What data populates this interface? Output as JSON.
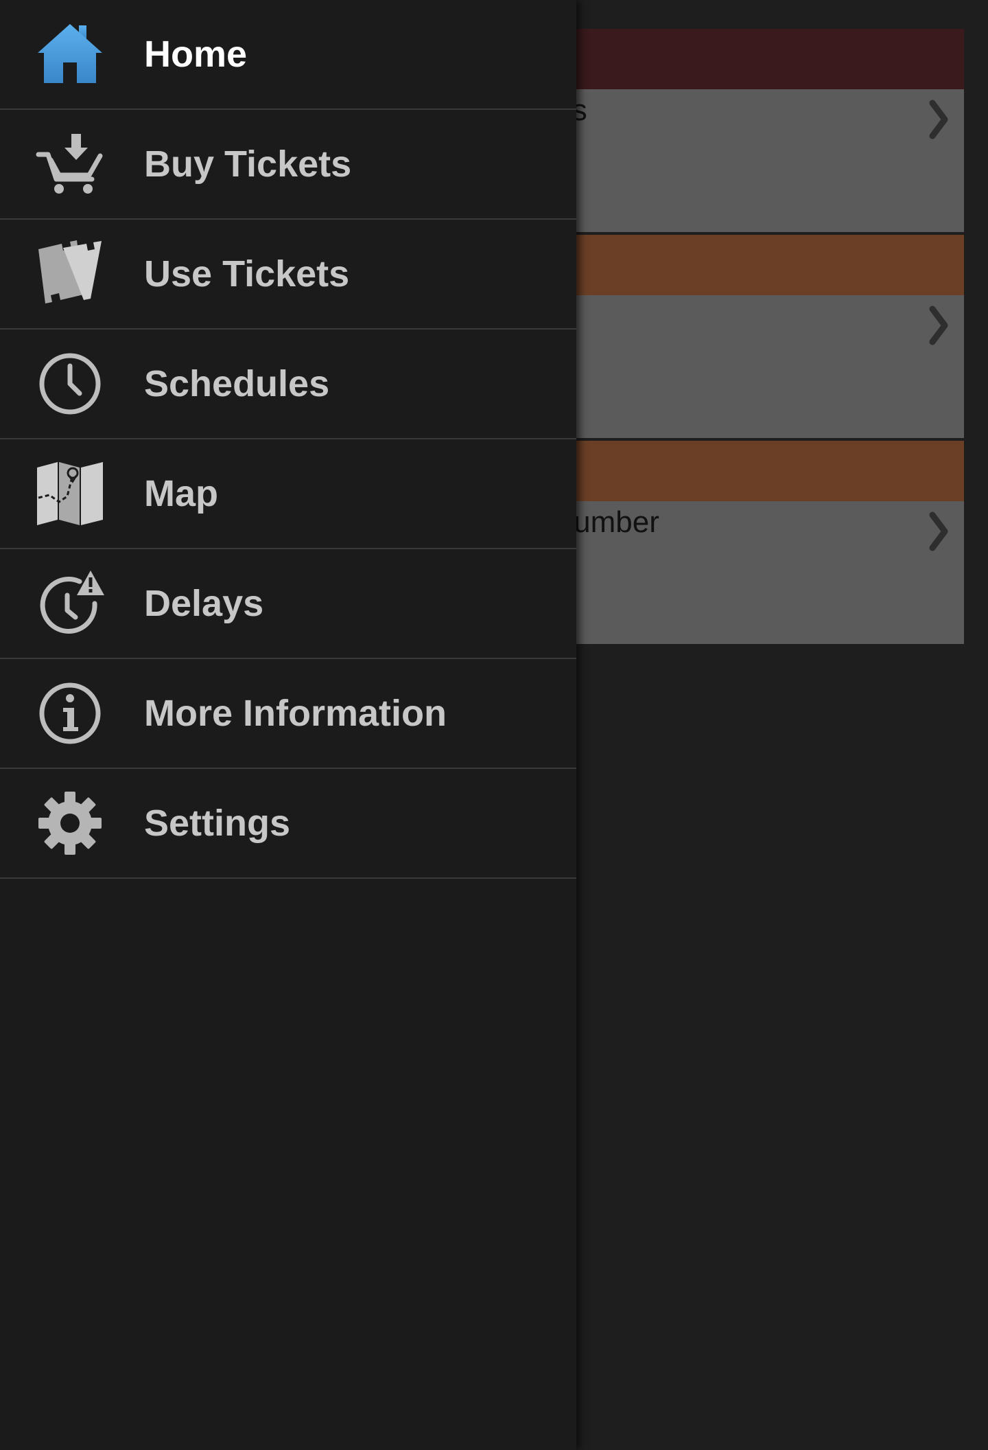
{
  "colors": {
    "drawer_bg": "#1b1b1b",
    "divider": "#3a3a3a",
    "label_default": "#c7c7c7",
    "label_active": "#ffffff",
    "icon_gray": "#bdbdbd",
    "home_icon_blue": "#4a9ee0",
    "card_header_red": "#3a1a1c",
    "card_header_orange": "#6a3f26",
    "card_body": "#5b5b5b"
  },
  "drawer": {
    "items": [
      {
        "label": "Home",
        "icon": "home-icon",
        "active": true
      },
      {
        "label": "Buy Tickets",
        "icon": "cart-download-icon",
        "active": false
      },
      {
        "label": "Use Tickets",
        "icon": "tickets-icon",
        "active": false
      },
      {
        "label": "Schedules",
        "icon": "clock-icon",
        "active": false
      },
      {
        "label": "Map",
        "icon": "map-icon",
        "active": false
      },
      {
        "label": "Delays",
        "icon": "clock-warning-icon",
        "active": false
      },
      {
        "label": "More Information",
        "icon": "info-icon",
        "active": false
      },
      {
        "label": "Settings",
        "icon": "gear-icon",
        "active": false
      }
    ]
  },
  "background": {
    "cards": [
      {
        "header_color": "#3a1a1c",
        "title": "kets"
      },
      {
        "header_color": "#6a3f26",
        "title": ""
      },
      {
        "header_color": "#6a3f26",
        "title": "e number"
      }
    ]
  }
}
